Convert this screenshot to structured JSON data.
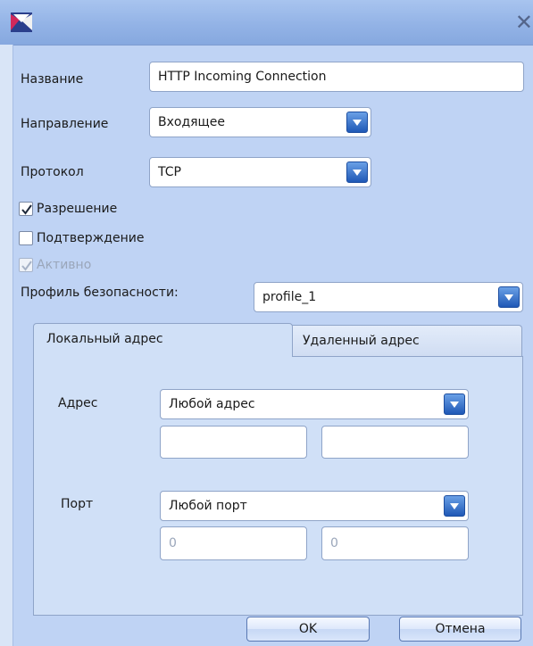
{
  "window": {
    "close_glyph": "✕"
  },
  "form": {
    "name_label": "Название",
    "name_value": "HTTP Incoming Connection",
    "direction_label": "Направление",
    "direction_value": "Входящее",
    "protocol_label": "Протокол",
    "protocol_value": "TCP",
    "permission_label": "Разрешение",
    "permission_checked": true,
    "confirmation_label": "Подтверждение",
    "confirmation_checked": false,
    "active_label": "Активно",
    "active_checked": true,
    "active_enabled": false,
    "security_profile_label": "Профиль безопасности:",
    "security_profile_value": "profile_1"
  },
  "tabs": [
    {
      "label": "Локальный адрес",
      "active": true
    },
    {
      "label": "Удаленный адрес",
      "active": false
    }
  ],
  "local_address": {
    "address_label": "Адрес",
    "address_mode": "Любой адрес",
    "address_from": "",
    "address_to": "",
    "port_label": "Порт",
    "port_mode": "Любой порт",
    "port_from": "0",
    "port_to": "0"
  },
  "buttons": {
    "ok_label": "OK",
    "cancel_label": "Отмена"
  },
  "colors": {
    "window_bg": "#bfd3f4",
    "titlebar": "#93b3e6",
    "dropdown_button": "#1f58b6"
  }
}
